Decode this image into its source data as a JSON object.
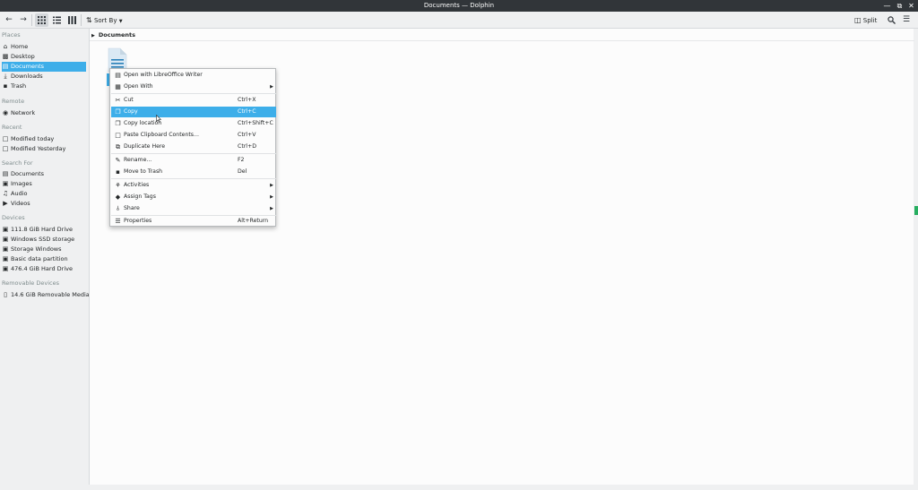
{
  "window": {
    "title": "Documents — Dolphin"
  },
  "toolbar": {
    "sort_label": "Sort By",
    "split_label": "Split"
  },
  "sidebar": {
    "places": {
      "header": "Places",
      "items": [
        {
          "label": "Home",
          "icon": "home-icon"
        },
        {
          "label": "Desktop",
          "icon": "desktop-icon"
        },
        {
          "label": "Documents",
          "icon": "documents-icon"
        },
        {
          "label": "Downloads",
          "icon": "downloads-icon"
        },
        {
          "label": "Trash",
          "icon": "trash-icon"
        }
      ]
    },
    "remote": {
      "header": "Remote",
      "items": [
        {
          "label": "Network",
          "icon": "network-icon"
        }
      ]
    },
    "recent": {
      "header": "Recent",
      "items": [
        {
          "label": "Modified today",
          "icon": "calendar-icon"
        },
        {
          "label": "Modified Yesterday",
          "icon": "calendar-icon"
        }
      ]
    },
    "search": {
      "header": "Search For",
      "items": [
        {
          "label": "Documents",
          "icon": "documents-icon"
        },
        {
          "label": "Images",
          "icon": "images-icon"
        },
        {
          "label": "Audio",
          "icon": "audio-icon"
        },
        {
          "label": "Videos",
          "icon": "videos-icon"
        }
      ]
    },
    "devices": {
      "header": "Devices",
      "items": [
        {
          "label": "111.8 GiB Hard Drive",
          "icon": "hard-drive-icon"
        },
        {
          "label": "Windows SSD storage",
          "icon": "hard-drive-icon"
        },
        {
          "label": "Storage Windows",
          "icon": "hard-drive-icon"
        },
        {
          "label": "Basic data partition",
          "icon": "hard-drive-icon"
        },
        {
          "label": "476.4 GiB Hard Drive",
          "icon": "hard-drive-icon"
        }
      ]
    },
    "removable": {
      "header": "Removable Devices",
      "items": [
        {
          "label": "14.6 GiB Removable Media",
          "icon": "usb-drive-icon"
        }
      ]
    }
  },
  "breadcrumb": {
    "current": "Documents"
  },
  "context_menu": {
    "items": [
      {
        "label": "Open with LibreOffice Writer",
        "shortcut": "",
        "icon": "writer-icon"
      },
      {
        "label": "Open With",
        "shortcut": "",
        "icon": "open-with-icon",
        "submenu": true
      },
      {
        "label": "Cut",
        "shortcut": "Ctrl+X",
        "icon": "cut-icon"
      },
      {
        "label": "Copy",
        "shortcut": "Ctrl+C",
        "icon": "copy-icon",
        "highlighted": true
      },
      {
        "label": "Copy location",
        "shortcut": "Ctrl+Shift+C",
        "icon": "copy-location-icon"
      },
      {
        "label": "Paste Clipboard Contents...",
        "shortcut": "Ctrl+V",
        "icon": "paste-icon"
      },
      {
        "label": "Duplicate Here",
        "shortcut": "Ctrl+D",
        "icon": "duplicate-icon"
      },
      {
        "label": "Rename...",
        "shortcut": "F2",
        "icon": "rename-icon"
      },
      {
        "label": "Move to Trash",
        "shortcut": "Del",
        "icon": "trash-icon"
      },
      {
        "label": "Activities",
        "shortcut": "",
        "icon": "activities-icon",
        "submenu": true
      },
      {
        "label": "Assign Tags",
        "shortcut": "",
        "icon": "tag-icon",
        "submenu": true
      },
      {
        "label": "Share",
        "shortcut": "",
        "icon": "share-icon",
        "submenu": true
      },
      {
        "label": "Properties",
        "shortcut": "Alt+Return",
        "icon": "properties-icon"
      }
    ]
  },
  "colors": {
    "accent": "#3daee9",
    "titlebar": "#313539",
    "window_bg": "#eff0f1",
    "view_bg": "#fcfcfc"
  }
}
